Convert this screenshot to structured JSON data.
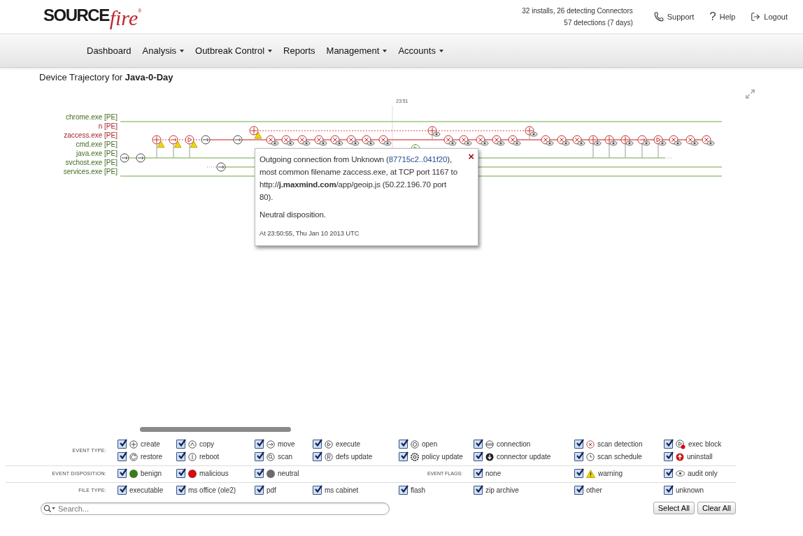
{
  "logo": {
    "bold": "SOURCE",
    "script": "fire",
    "mark": "®"
  },
  "stats": [
    "32 installs, 26 detecting Connectors",
    "57 detections (7 days)"
  ],
  "header_links": [
    {
      "label": "Support",
      "kind": "phone"
    },
    {
      "label": "Help",
      "kind": "help",
      "glyph": "?"
    },
    {
      "label": "Logout",
      "kind": "logout"
    }
  ],
  "nav": [
    {
      "label": "Dashboard",
      "dropdown": false
    },
    {
      "label": "Analysis",
      "dropdown": true
    },
    {
      "label": "Outbreak Control",
      "dropdown": true
    },
    {
      "label": "Reports",
      "dropdown": false
    },
    {
      "label": "Management",
      "dropdown": true
    },
    {
      "label": "Accounts",
      "dropdown": true
    }
  ],
  "title": "Device Trajectory for **Java-0-Day**",
  "trajectory": {
    "time_label": "23:51",
    "lanes": [
      {
        "name": "chrome.exe",
        "tag": "[PE]",
        "color": "#3f6b1f"
      },
      {
        "name": "n",
        "tag": "[PE]",
        "color": "#a8202a"
      },
      {
        "name": "zaccess.exe",
        "tag": "[PE]",
        "color": "#a8202a"
      },
      {
        "name": "cmd.exe",
        "tag": "[PE]",
        "color": "#3f6b1f"
      },
      {
        "name": "java.exe",
        "tag": "[PE]",
        "color": "#3f6b1f"
      },
      {
        "name": "svchost.exe",
        "tag": "[PE]",
        "color": "#3f6b1f"
      },
      {
        "name": "services.exe",
        "tag": "[PE]",
        "color": "#3f6b1f"
      }
    ]
  },
  "tooltip": {
    "before": "Outgoing connection from Unknown (",
    "link": "87715c2..041f20",
    "after": "), most common filename zaccess.exe, at TCP port 1167 to http://**j.maxmind.com**/app/geoip.js (50.22.196.70 port 80).",
    "disposition": "Neutral disposition.",
    "time": "At 23:50:55, Thu Jan 10 2013 UTC",
    "close": "×"
  },
  "filters": {
    "event_type": {
      "label": "EVENT TYPE:",
      "items": [
        {
          "label": "create",
          "checked": true
        },
        {
          "label": "copy",
          "checked": true
        },
        {
          "label": "move",
          "checked": true
        },
        {
          "label": "execute",
          "checked": true
        },
        {
          "label": "open",
          "checked": true
        },
        {
          "label": "connection",
          "checked": true
        },
        {
          "label": "scan detection",
          "checked": true
        },
        {
          "label": "exec block",
          "checked": true
        },
        {
          "label": "restore",
          "checked": true
        },
        {
          "label": "reboot",
          "checked": true
        },
        {
          "label": "scan",
          "checked": true
        },
        {
          "label": "defs update",
          "checked": true
        },
        {
          "label": "policy update",
          "checked": true
        },
        {
          "label": "connector update",
          "checked": true
        },
        {
          "label": "scan schedule",
          "checked": true
        },
        {
          "label": "uninstall",
          "checked": true
        }
      ]
    },
    "disposition": {
      "label": "EVENT DISPOSITION:",
      "items": [
        {
          "label": "benign",
          "checked": true,
          "color": "#3a7d1a"
        },
        {
          "label": "malicious",
          "checked": true,
          "color": "#cc1111"
        },
        {
          "label": "neutral",
          "checked": true,
          "color": "#6b6b6b"
        }
      ]
    },
    "flags": {
      "label": "EVENT FLAGS:",
      "items": [
        {
          "label": "none",
          "checked": true
        },
        {
          "label": "warning",
          "checked": true
        },
        {
          "label": "audit only",
          "checked": true
        }
      ]
    },
    "file_type": {
      "label": "FILE TYPE:",
      "items": [
        {
          "label": "executable",
          "checked": true
        },
        {
          "label": "ms office (ole2)",
          "checked": true
        },
        {
          "label": "pdf",
          "checked": true
        },
        {
          "label": "ms cabinet",
          "checked": true
        },
        {
          "label": "flash",
          "checked": true
        },
        {
          "label": "zip archive",
          "checked": true
        },
        {
          "label": "other",
          "checked": true
        },
        {
          "label": "unknown",
          "checked": true
        }
      ]
    }
  },
  "search": {
    "placeholder": "Search..."
  },
  "buttons": [
    "Select All",
    "Clear All"
  ]
}
